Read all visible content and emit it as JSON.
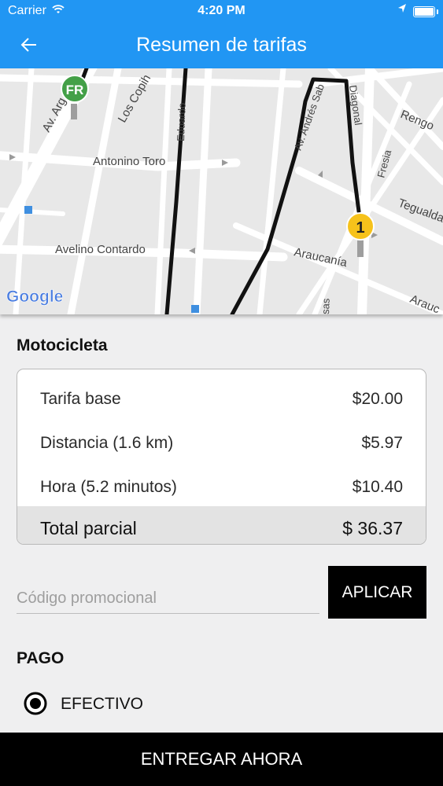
{
  "status_bar": {
    "carrier": "Carrier",
    "time": "4:20 PM"
  },
  "header": {
    "title": "Resumen de tarifas"
  },
  "map": {
    "streets": [
      "Av. Arg",
      "Los Copih",
      "Eduardo",
      "Antonino Toro",
      "Avelino Contardo",
      "Av. Andrés Sab",
      "Diagonal",
      "Rengo",
      "Fresia",
      "Tegualda",
      "Araucanía",
      "Arauc",
      "sas"
    ],
    "start_marker": "FR",
    "end_marker": "1",
    "attribution": "Google",
    "colors": {
      "route": "#111111",
      "start_marker": "#43a047",
      "end_marker": "#f6c21b"
    }
  },
  "vehicle": {
    "title": "Motocicleta"
  },
  "fare": {
    "rows": [
      {
        "label": "Tarifa base",
        "value": "$20.00"
      },
      {
        "label": "Distancia (1.6 km)",
        "value": "$5.97"
      },
      {
        "label": "Hora (5.2 minutos)",
        "value": "$10.40"
      }
    ],
    "total": {
      "label": "Total parcial",
      "value": "$ 36.37"
    }
  },
  "promo": {
    "placeholder": "Código promocional",
    "apply_label": "APLICAR"
  },
  "payment": {
    "title": "PAGO",
    "option": "EFECTIVO",
    "selected": true
  },
  "cta": {
    "label": "ENTREGAR AHORA"
  },
  "colors": {
    "primary": "#2196f3",
    "button": "#000000"
  }
}
